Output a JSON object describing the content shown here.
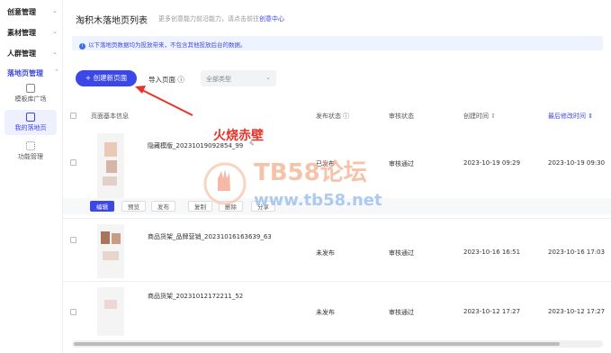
{
  "sidebar": {
    "groups": [
      {
        "label": "创意管理"
      },
      {
        "label": "素材管理"
      },
      {
        "label": "人群管理"
      },
      {
        "label": "落地页管理"
      }
    ],
    "subitems": [
      {
        "label": "模板库广场"
      },
      {
        "label": "我的落地页"
      },
      {
        "label": "功能管理"
      }
    ]
  },
  "header": {
    "title": "淘积木落地页列表",
    "subtitle": "更多创意能力前沿能力，请点击前往",
    "subtitle_link": "创意中心"
  },
  "notice": {
    "text": "以下落地页数据均为投放带来，不包含其他投放后台的数据。"
  },
  "toolbar": {
    "create_label": "+ 创建新页面",
    "import_label": "导入页面 ⓘ",
    "type_select_value": "全部类型"
  },
  "table": {
    "headers": {
      "name": "页面基本信息",
      "publish": "发布状态 ⓘ",
      "audit": "审核状态",
      "created": "创建时间",
      "modified": "最后修改时间"
    },
    "rows": [
      {
        "name": "隐藏模版_20231019092854_99",
        "publish": "已发布",
        "audit": "审核通过",
        "created": "2023-10-19 09:29",
        "modified": "2023-10-19 09:30"
      },
      {
        "name": "商品货架_品牌营销_20231016163639_63",
        "publish": "未发布",
        "audit": "审核通过",
        "created": "2023-10-16 16:51",
        "modified": "2023-10-16 17:03"
      },
      {
        "name": "商品货架_20231012172211_52",
        "publish": "未发布",
        "audit": "审核通过",
        "created": "2023-10-12 17:27",
        "modified": "2023-10-12 17:27"
      }
    ],
    "actions": [
      "编辑",
      "预览",
      "发布",
      "复制",
      "删除",
      "分享"
    ]
  },
  "watermark": {
    "title": "火烧赤壁",
    "site": "TB58论坛",
    "url": "www.tb58.net"
  },
  "colors": {
    "accent": "#3b47e6",
    "arrow": "#e8322a"
  }
}
